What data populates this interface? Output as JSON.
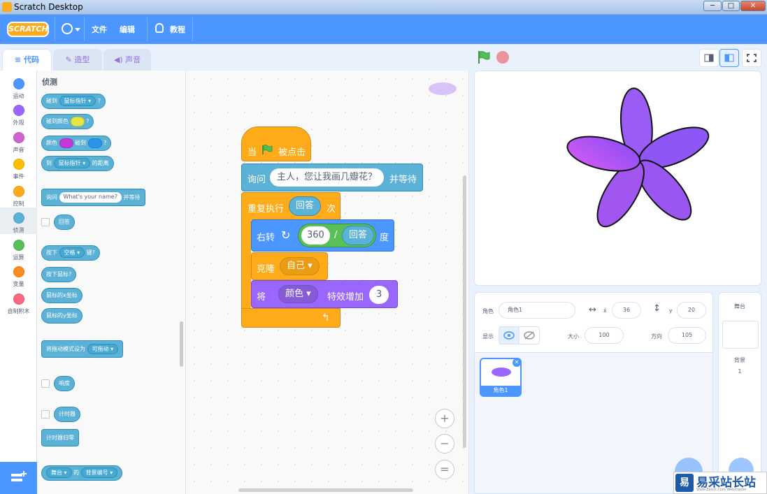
{
  "window": {
    "title": "Scratch Desktop",
    "buttons": [
      "─",
      "□",
      "✕"
    ]
  },
  "menubar": {
    "logo": "SCRATCH",
    "file": "文件",
    "edit": "编辑",
    "tutorials": "教程"
  },
  "tabs": {
    "code": "代码",
    "costumes": "造型",
    "sounds": "声音"
  },
  "categories": [
    {
      "label": "运动",
      "color": "#4c97ff"
    },
    {
      "label": "外观",
      "color": "#9966ff"
    },
    {
      "label": "声音",
      "color": "#cf63cf"
    },
    {
      "label": "事件",
      "color": "#ffbf00"
    },
    {
      "label": "控制",
      "color": "#ffab19"
    },
    {
      "label": "侦测",
      "color": "#5cb1d6"
    },
    {
      "label": "运算",
      "color": "#59c059"
    },
    {
      "label": "变量",
      "color": "#ff8c1a"
    },
    {
      "label": "自制积木",
      "color": "#ff6680"
    }
  ],
  "palette": {
    "title": "侦测",
    "touching": {
      "text": "碰到",
      "menu": "鼠标指针",
      "q": "?"
    },
    "touching_color": {
      "text": "碰到颜色",
      "q": "?"
    },
    "color_touching": {
      "a": "颜色",
      "b": "碰到",
      "q": "?"
    },
    "distance": {
      "a": "到",
      "menu": "鼠标指针",
      "b": "的距离"
    },
    "ask": {
      "a": "询问",
      "input": "What's your name?",
      "b": "并等待"
    },
    "answer": "回答",
    "key_pressed": {
      "a": "按下",
      "menu": "空格",
      "b": "键?"
    },
    "mouse_down": "按下鼠标?",
    "mouse_x": "鼠标的x坐标",
    "mouse_y": "鼠标的y坐标",
    "drag_mode": {
      "a": "将拖动模式设为",
      "menu": "可拖动"
    },
    "loudness": "响度",
    "timer": "计时器",
    "reset_timer": "计时器归零",
    "backdrop_of": {
      "menu1": "舞台",
      "a": "的",
      "menu2": "背景编号"
    }
  },
  "script": {
    "hat": {
      "a": "当",
      "b": "被点击"
    },
    "ask": {
      "a": "询问",
      "input": "主人，您让我画几瓣花？",
      "b": "并等待"
    },
    "repeat": {
      "a": "重复执行",
      "reporter": "回答",
      "b": "次"
    },
    "turn": {
      "a": "右转",
      "num": "360",
      "op": "/",
      "reporter": "回答",
      "b": "度"
    },
    "clone": {
      "a": "克隆",
      "menu": "自己"
    },
    "effect": {
      "a": "将",
      "menu": "颜色",
      "b": "特效增加",
      "value": "3"
    },
    "zoom_in": "+",
    "zoom_out": "−",
    "zoom_reset": "="
  },
  "sprite_info": {
    "sprite_label": "角色",
    "sprite_name": "角色1",
    "x_label": "x",
    "x_value": "36",
    "y_label": "y",
    "y_value": "20",
    "show_label": "显示",
    "size_label": "大小",
    "size_value": "100",
    "direction_label": "方向",
    "direction_value": "105",
    "sprite_card_name": "角色1"
  },
  "stage_pane": {
    "title": "舞台",
    "backdrops_label": "背景",
    "backdrops_count": "1"
  },
  "watermark": {
    "icon": "易",
    "text": "易采站长站",
    "sub": "Www.Easck.Com Webmaster"
  },
  "colors": {
    "menubar": "#4c97ff",
    "petal_fill": "#9966ff",
    "petal_top": "#cf63ff"
  }
}
